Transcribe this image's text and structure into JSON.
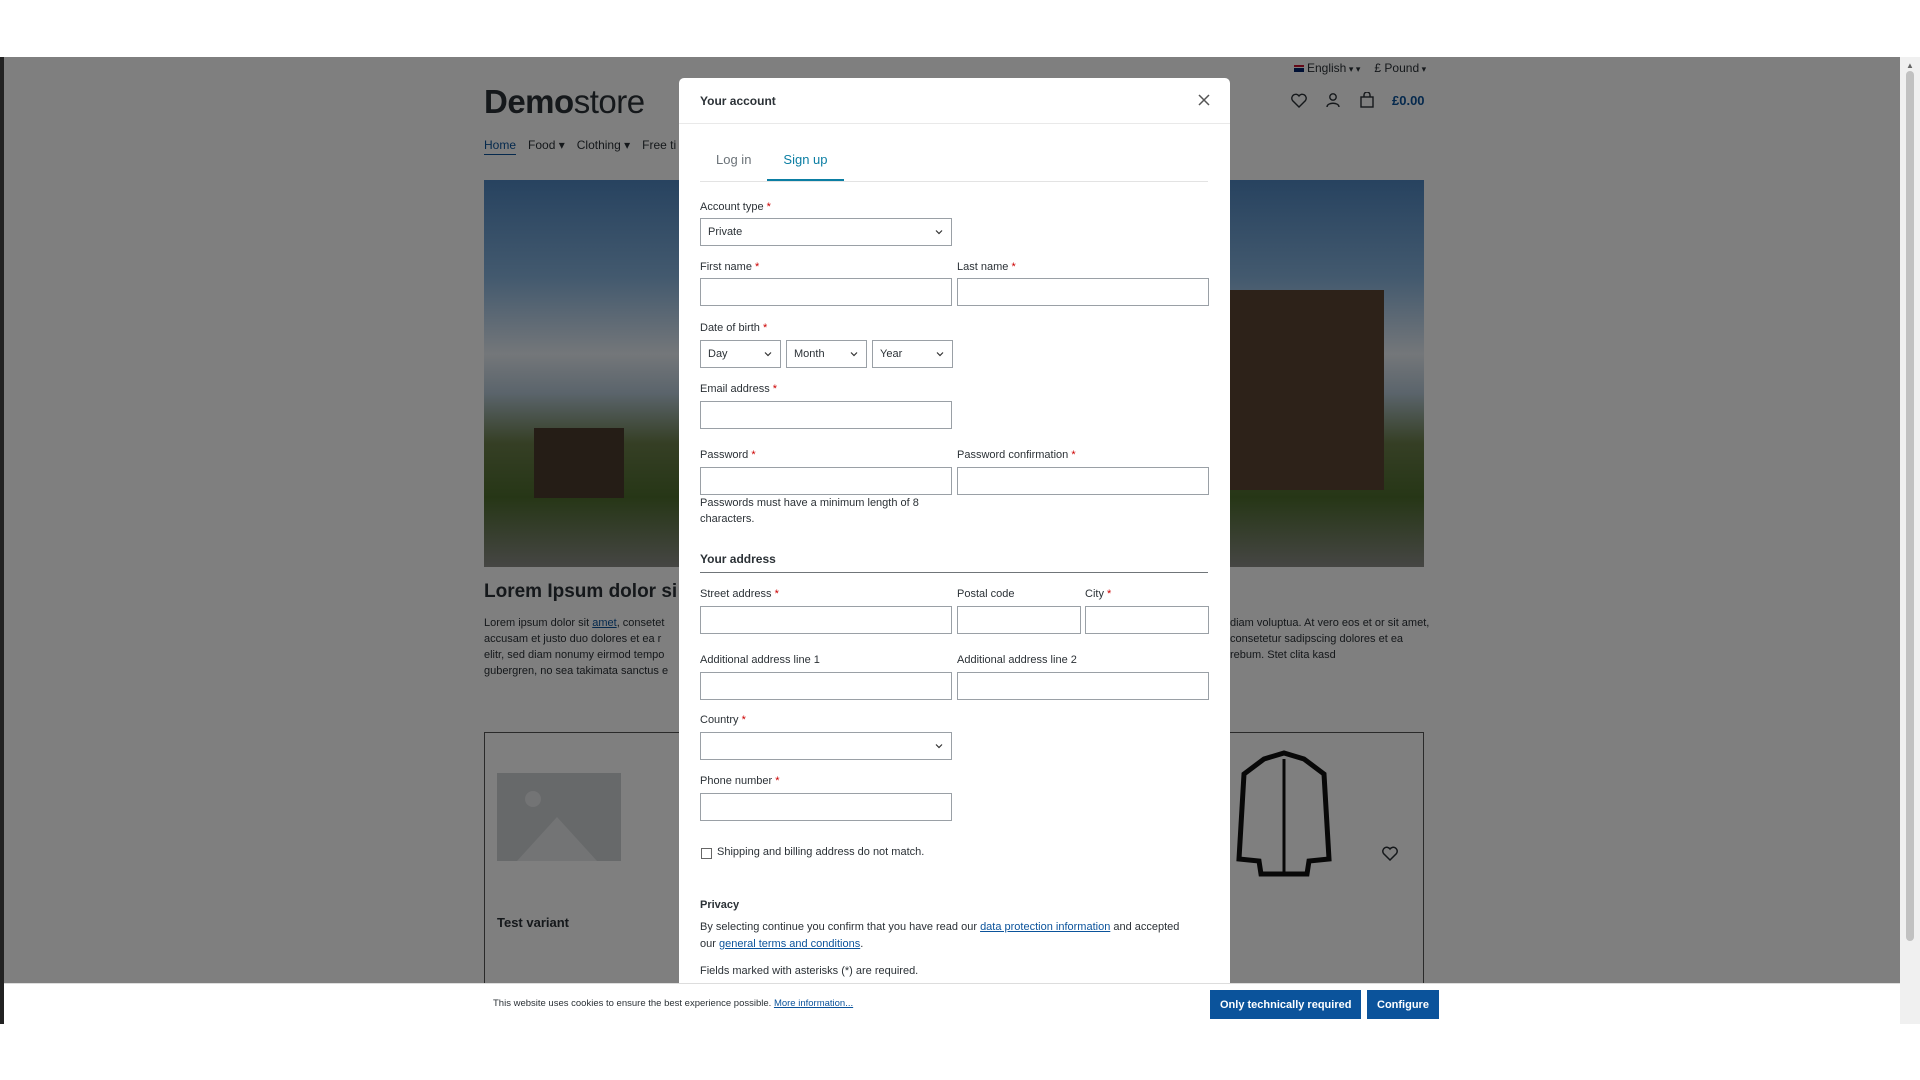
{
  "topbar": {
    "language": "English",
    "currency": "£ Pound"
  },
  "logo": {
    "bold": "Demo",
    "light": "store"
  },
  "header": {
    "cart_total": "£0.00"
  },
  "nav": {
    "items": [
      "Home",
      "Food",
      "Clothing",
      "Free ti"
    ]
  },
  "content": {
    "heading": "Lorem Ipsum dolor si",
    "para_left_prefix": "Lorem ipsum dolor sit ",
    "para_left_link": "amet",
    "para_left_suffix": ", consetet accusam et justo duo dolores et ea r elitr, sed diam nonumy eirmod tempo gubergren, no sea takimata sanctus e",
    "para_right": "diam voluptua. At vero eos et or sit amet, consetetur sadipscing dolores et ea rebum. Stet clita kasd",
    "card_title": "Test variant"
  },
  "modal": {
    "title": "Your account",
    "tabs": [
      "Log in",
      "Sign up"
    ],
    "account_type_label": "Account type",
    "account_type_value": "Private",
    "first_name_label": "First name",
    "last_name_label": "Last name",
    "dob_label": "Date of birth",
    "dob_day": "Day",
    "dob_month": "Month",
    "dob_year": "Year",
    "email_label": "Email address",
    "password_label": "Password",
    "password_confirm_label": "Password confirmation",
    "password_hint": "Passwords must have a minimum length of 8 characters.",
    "address_section": "Your address",
    "street_label": "Street address",
    "postal_label": "Postal code",
    "city_label": "City",
    "address1_label": "Additional address line 1",
    "address2_label": "Additional address line 2",
    "country_label": "Country",
    "phone_label": "Phone number",
    "shipping_checkbox_label": "Shipping and billing address do not match.",
    "privacy_title": "Privacy",
    "privacy_text_1": "By selecting continue you confirm that you have read our ",
    "privacy_link_1": "data protection information",
    "privacy_text_2": " and accepted our ",
    "privacy_link_2": "general terms and conditions",
    "privacy_text_3": ".",
    "fields_note": "Fields marked with asterisks (*) are required.",
    "required_mark": "*"
  },
  "cookie": {
    "text": "This website uses cookies to ensure the best experience possible. ",
    "link": "More information...",
    "btn_required": "Only technically required",
    "btn_configure": "Configure"
  }
}
